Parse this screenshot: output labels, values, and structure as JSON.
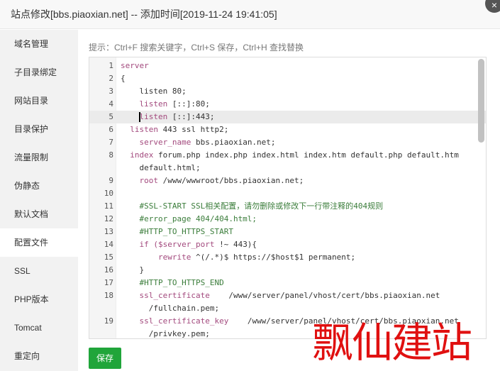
{
  "header": {
    "title": "站点修改[bbs.piaoxian.net] -- 添加时间[2019-11-24 19:41:05]",
    "close_icon": "×"
  },
  "sidebar": {
    "items": [
      {
        "label": "域名管理"
      },
      {
        "label": "子目录绑定"
      },
      {
        "label": "网站目录"
      },
      {
        "label": "目录保护"
      },
      {
        "label": "流量限制"
      },
      {
        "label": "伪静态"
      },
      {
        "label": "默认文档"
      },
      {
        "label": "配置文件",
        "active": true
      },
      {
        "label": "SSL"
      },
      {
        "label": "PHP版本"
      },
      {
        "label": "Tomcat"
      },
      {
        "label": "重定向"
      }
    ]
  },
  "hint": "提示：Ctrl+F 搜索关键字，Ctrl+S 保存，Ctrl+H 查找替换",
  "editor": {
    "rows": [
      {
        "n": "1",
        "kw": "server",
        "rest": ""
      },
      {
        "n": "2",
        "kw": "",
        "rest": "{"
      },
      {
        "n": "3",
        "kw": "",
        "rest": "    listen 80;"
      },
      {
        "n": "4",
        "kw": "    listen",
        "rest": " [::]:80;"
      },
      {
        "n": "5",
        "kw": "    listen",
        "rest": " [::]:443;"
      },
      {
        "n": "6",
        "kw": "  listen",
        "rest": " 443 ssl http2;"
      },
      {
        "n": "7",
        "kw": "    server_name",
        "rest": " bbs.piaoxian.net;"
      },
      {
        "n": "8",
        "kw": "  index",
        "rest": " forum.php index.php index.html index.htm default.php default.htm"
      },
      {
        "n": "",
        "kw": "",
        "rest": "    default.html;"
      },
      {
        "n": "9",
        "kw": "    root",
        "rest": " /www/wwwroot/bbs.piaoxian.net;"
      },
      {
        "n": "10",
        "kw": "",
        "rest": ""
      },
      {
        "n": "11",
        "cm": "    #SSL-START SSL相关配置，请勿删除或修改下一行带注释的404规则"
      },
      {
        "n": "12",
        "cm": "    #error_page 404/404.html;"
      },
      {
        "n": "13",
        "cm": "    #HTTP_TO_HTTPS_START"
      },
      {
        "n": "14",
        "kw": "    if ($server_port",
        "rest": " !~ 443){"
      },
      {
        "n": "15",
        "kw": "        rewrite",
        "rest": " ^(/.*)$ https://$host$1 permanent;"
      },
      {
        "n": "16",
        "kw": "",
        "rest": "    }"
      },
      {
        "n": "17",
        "cm": "    #HTTP_TO_HTTPS_END"
      },
      {
        "n": "18",
        "kw": "    ssl_certificate",
        "rest": "    /www/server/panel/vhost/cert/bbs.piaoxian.net"
      },
      {
        "n": "",
        "kw": "",
        "rest": "      /fullchain.pem;"
      },
      {
        "n": "19",
        "kw": "    ssl_certificate_key",
        "rest": "    /www/server/panel/vhost/cert/bbs.piaoxian.net"
      },
      {
        "n": "",
        "kw": "",
        "rest": "      /privkey.pem;"
      }
    ]
  },
  "save_label": "保存",
  "watermark": "飘仙建站",
  "colors": {
    "accent": "#20a53a",
    "watermark": "#e01010"
  }
}
